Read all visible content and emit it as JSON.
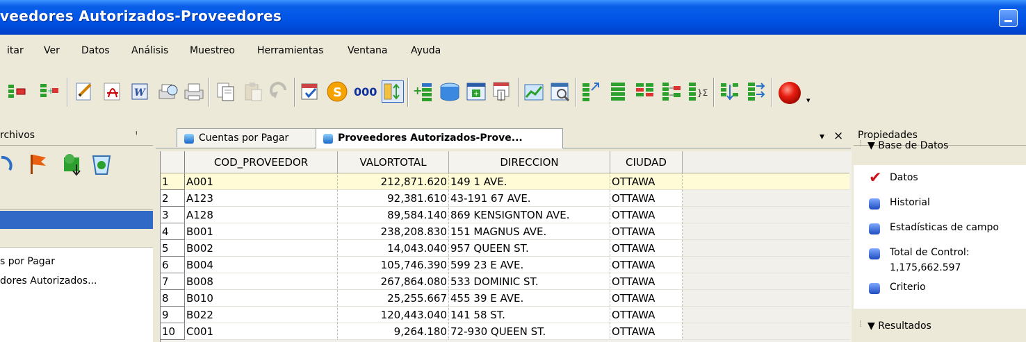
{
  "window": {
    "title": "veedores Autorizados-Proveedores"
  },
  "menu": [
    "itar",
    "Ver",
    "Datos",
    "Análisis",
    "Muestreo",
    "Herramientas",
    "Ventana",
    "Ayuda"
  ],
  "toolbar": {
    "icons": [
      "append-field-icon",
      "insert-field-icon",
      "edit-icon",
      "acrobat-pdf-icon",
      "word-export-icon",
      "print-preview-icon",
      "print-icon",
      "copy-icon",
      "paste-icon",
      "undo-icon",
      "stratify-icon",
      "currency-icon",
      "number-format-icon",
      "sort-icon",
      "add-field-icon",
      "database-icon",
      "calculator-icon",
      "pivot-icon",
      "chart-icon",
      "report-icon",
      "extract-icon",
      "summarize-icon",
      "index-icon",
      "join-icon",
      "sum-icon",
      "merge-icon",
      "export-icon",
      "stop-icon"
    ],
    "overflow": "▾"
  },
  "left_panel": {
    "title": "rchivos",
    "pin": "ᵖ",
    "files": [
      "s por Pagar",
      "dores Autorizados..."
    ]
  },
  "tabs": [
    {
      "label": "Cuentas por Pagar",
      "active": false
    },
    {
      "label": "Proveedores Autorizados-Prove...",
      "active": true
    }
  ],
  "tab_controls": {
    "dropdown": "▾",
    "close": "×"
  },
  "table": {
    "columns": [
      "COD_PROVEEDOR",
      "VALORTOTAL",
      "DIRECCION",
      "CIUDAD"
    ],
    "rows": [
      [
        "1",
        "A001",
        "212,871.620",
        "149 1 AVE.",
        "OTTAWA"
      ],
      [
        "2",
        "A123",
        "92,381.610",
        "43-191 67 AVE.",
        "OTTAWA"
      ],
      [
        "3",
        "A128",
        "89,584.140",
        "869 KENSIGNTON AVE.",
        "OTTAWA"
      ],
      [
        "4",
        "B001",
        "238,208.830",
        "151 MAGNUS AVE.",
        "OTTAWA"
      ],
      [
        "5",
        "B002",
        "14,043.040",
        "957 QUEEN ST.",
        "OTTAWA"
      ],
      [
        "6",
        "B004",
        "105,746.390",
        "599 23 E AVE.",
        "OTTAWA"
      ],
      [
        "7",
        "B008",
        "267,864.080",
        "533 DOMINIC ST.",
        "OTTAWA"
      ],
      [
        "8",
        "B010",
        "25,255.667",
        "455 39 E AVE.",
        "OTTAWA"
      ],
      [
        "9",
        "B022",
        "120,443.040",
        "141 58 ST.",
        "OTTAWA"
      ],
      [
        "10",
        "C001",
        "9,264.180",
        "72-930 QUEEN ST.",
        "OTTAWA"
      ]
    ],
    "selected_row": 0
  },
  "right_panel": {
    "title": "Propiedades",
    "section_db": "▼ Base de Datos",
    "items": [
      "Datos",
      "Historial",
      "Estadísticas de campo",
      "Total de Control:",
      "Criterio"
    ],
    "control_total": "1,175,662.597",
    "section_results": "▼ Resultados"
  },
  "colors": {
    "title_blue": "#0053E6",
    "selection_blue": "#3169C6",
    "row_highlight": "#FFFBD6",
    "check_red": "#D0141C"
  }
}
